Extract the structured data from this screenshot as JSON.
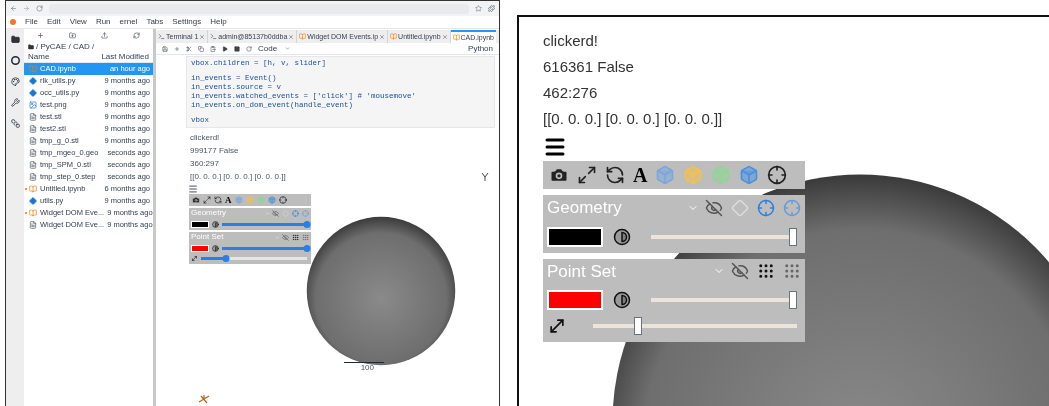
{
  "menu": [
    "File",
    "Edit",
    "View",
    "Run",
    "ernel",
    "Tabs",
    "Settings",
    "Help"
  ],
  "file_browser": {
    "path": "/ PyCAE / CAD /",
    "columns": [
      "Name",
      "Last Modified"
    ],
    "files": [
      {
        "name": "CAD.ipynb",
        "modified": "an hour ago",
        "kind": "notebook",
        "selected": true,
        "running": false
      },
      {
        "name": "rlk_utils.py",
        "modified": "9 months ago",
        "kind": "python",
        "selected": false,
        "running": false
      },
      {
        "name": "occ_utils.py",
        "modified": "9 months ago",
        "kind": "python",
        "selected": false,
        "running": false
      },
      {
        "name": "test.png",
        "modified": "9 months ago",
        "kind": "image",
        "selected": false,
        "running": false
      },
      {
        "name": "test.stl",
        "modified": "9 months ago",
        "kind": "file",
        "selected": false,
        "running": false
      },
      {
        "name": "test2.stl",
        "modified": "9 months ago",
        "kind": "file",
        "selected": false,
        "running": false
      },
      {
        "name": "tmp_g_0.stl",
        "modified": "9 months ago",
        "kind": "file",
        "selected": false,
        "running": false
      },
      {
        "name": "tmp_mgeo_0.geo",
        "modified": "seconds ago",
        "kind": "file",
        "selected": false,
        "running": false
      },
      {
        "name": "tmp_SPM_0.stl",
        "modified": "seconds ago",
        "kind": "file",
        "selected": false,
        "running": false
      },
      {
        "name": "tmp_step_0.step",
        "modified": "seconds ago",
        "kind": "file",
        "selected": false,
        "running": false
      },
      {
        "name": "Untitled.ipynb",
        "modified": "6 months ago",
        "kind": "notebook",
        "selected": false,
        "running": true
      },
      {
        "name": "utils.py",
        "modified": "9 months ago",
        "kind": "python",
        "selected": false,
        "running": false
      },
      {
        "name": "Widget DOM Eve...",
        "modified": "9 months ago",
        "kind": "notebook",
        "selected": false,
        "running": true
      },
      {
        "name": "Widget DOM Eve...",
        "modified": "9 months ago",
        "kind": "file",
        "selected": false,
        "running": false
      }
    ]
  },
  "tabs": [
    {
      "label": "Terminal 1",
      "kind": "terminal",
      "selected": false
    },
    {
      "label": "admin@85137b0ddba",
      "kind": "terminal",
      "selected": false
    },
    {
      "label": "Widget DOM Events.ip",
      "kind": "notebook",
      "selected": false
    },
    {
      "label": "Untitled.ipynb",
      "kind": "notebook",
      "selected": false
    },
    {
      "label": "CAD.ipynb",
      "kind": "notebook",
      "selected": true
    }
  ],
  "toolbar": {
    "cell_type": "Code",
    "kernel": "Python"
  },
  "code": [
    [
      "vbox.children = [h, v, slider]"
    ],
    [
      "in_events = Event()",
      "in_events.source = v",
      "in_events.watched_events = ['click'] # 'mousemove'",
      "in_events.on_dom_event(handle_event)"
    ],
    [
      "vbox"
    ]
  ],
  "outputs": [
    "clickerd!",
    "999177 False",
    "360:297",
    "[[0. 0. 0.] [0. 0. 0.] [0. 0. 0.]]"
  ],
  "viewer": {
    "toolbar_letter": "A",
    "scale_label": "100",
    "panels": [
      {
        "name": "Geometry",
        "kind": "surface",
        "color": "#000000",
        "level": 1
      },
      {
        "name": "Point Set",
        "kind": "points",
        "color": "#ff0000",
        "level": 1,
        "size_slider": {
          "level": 0.24
        }
      }
    ]
  },
  "zoom_view": {
    "outputs": [
      "clickerd!",
      "616361 False",
      "462:276",
      "[[0. 0. 0.] [0. 0. 0.] [0. 0. 0.]]"
    ],
    "toolbar_letter": "A",
    "panels": [
      {
        "name": "Geometry",
        "kind": "surface",
        "color": "#000000",
        "level": 1
      },
      {
        "name": "Point Set",
        "kind": "points",
        "color": "#ff0000",
        "level": 1,
        "size_slider": {
          "level": 0.24
        }
      }
    ]
  }
}
